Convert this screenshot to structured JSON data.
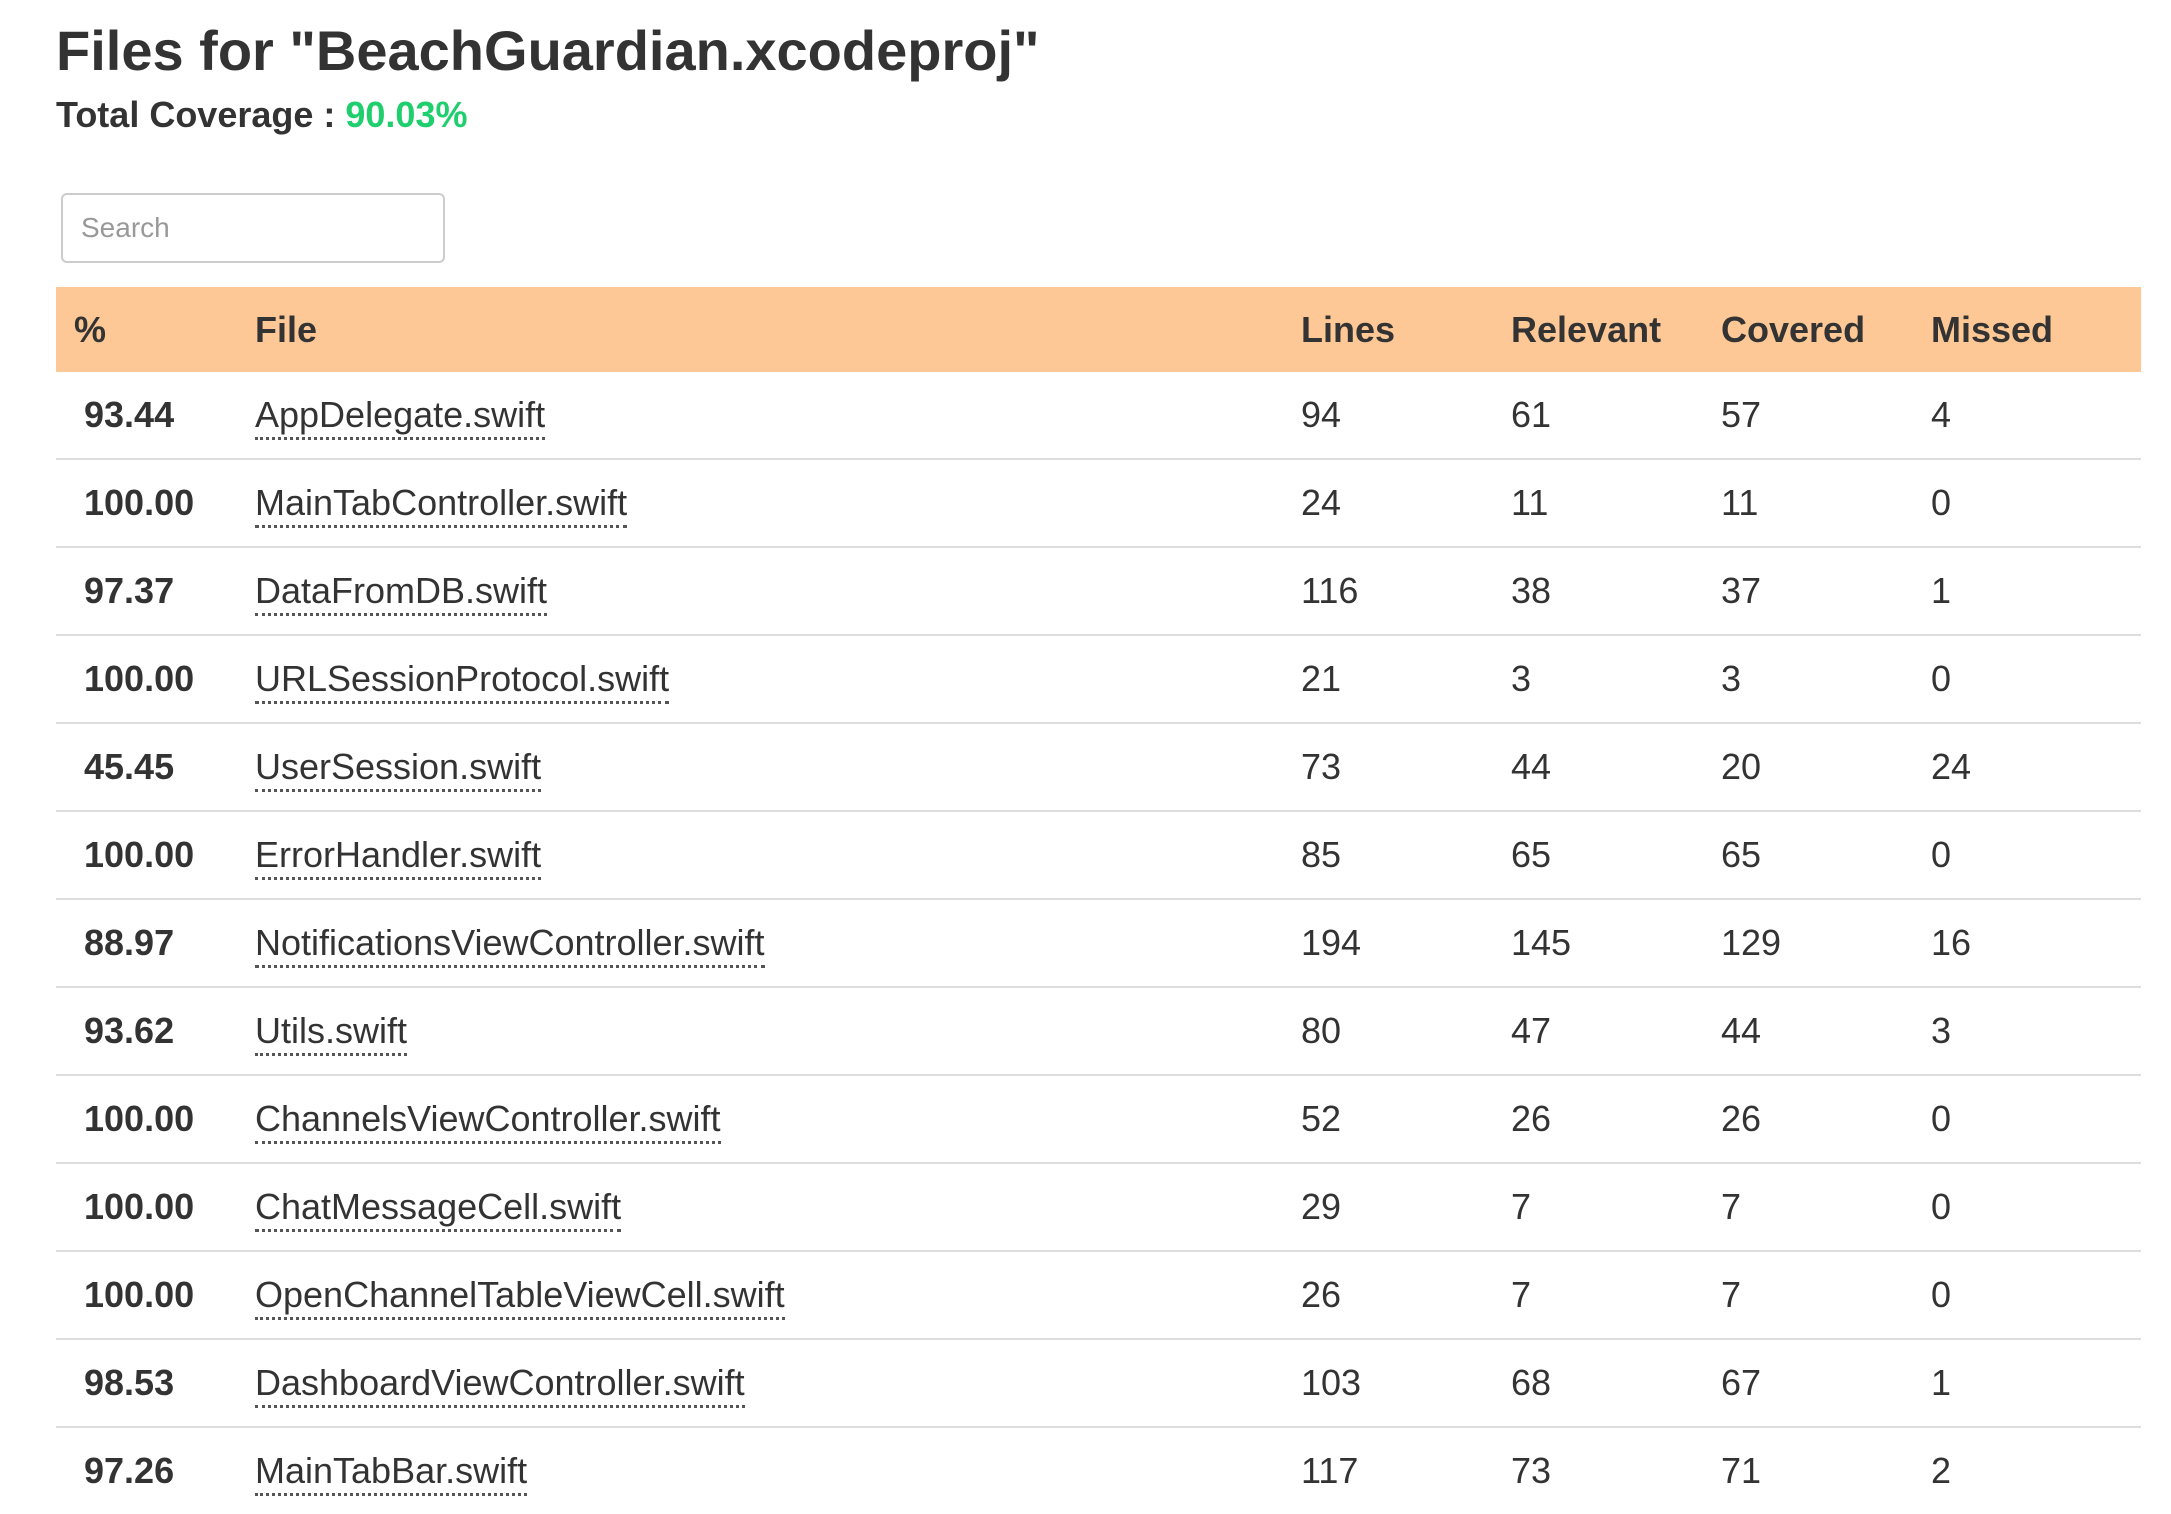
{
  "page": {
    "title": "Files for \"BeachGuardian.xcodeproj\"",
    "coverage_label": "Total Coverage : ",
    "coverage_value": "90.03%"
  },
  "search": {
    "placeholder": "Search"
  },
  "table": {
    "headers": {
      "pct": "%",
      "file": "File",
      "lines": "Lines",
      "relevant": "Relevant",
      "covered": "Covered",
      "missed": "Missed"
    },
    "rows": [
      {
        "pct": "93.44",
        "level": "high",
        "file": "AppDelegate.swift",
        "lines": "94",
        "relevant": "61",
        "covered": "57",
        "missed": "4"
      },
      {
        "pct": "100.00",
        "level": "high",
        "file": "MainTabController.swift",
        "lines": "24",
        "relevant": "11",
        "covered": "11",
        "missed": "0"
      },
      {
        "pct": "97.37",
        "level": "high",
        "file": "DataFromDB.swift",
        "lines": "116",
        "relevant": "38",
        "covered": "37",
        "missed": "1"
      },
      {
        "pct": "100.00",
        "level": "high",
        "file": "URLSessionProtocol.swift",
        "lines": "21",
        "relevant": "3",
        "covered": "3",
        "missed": "0"
      },
      {
        "pct": "45.45",
        "level": "low",
        "file": "UserSession.swift",
        "lines": "73",
        "relevant": "44",
        "covered": "20",
        "missed": "24"
      },
      {
        "pct": "100.00",
        "level": "high",
        "file": "ErrorHandler.swift",
        "lines": "85",
        "relevant": "65",
        "covered": "65",
        "missed": "0"
      },
      {
        "pct": "88.97",
        "level": "high",
        "file": "NotificationsViewController.swift",
        "lines": "194",
        "relevant": "145",
        "covered": "129",
        "missed": "16"
      },
      {
        "pct": "93.62",
        "level": "high",
        "file": "Utils.swift",
        "lines": "80",
        "relevant": "47",
        "covered": "44",
        "missed": "3"
      },
      {
        "pct": "100.00",
        "level": "high",
        "file": "ChannelsViewController.swift",
        "lines": "52",
        "relevant": "26",
        "covered": "26",
        "missed": "0"
      },
      {
        "pct": "100.00",
        "level": "high",
        "file": "ChatMessageCell.swift",
        "lines": "29",
        "relevant": "7",
        "covered": "7",
        "missed": "0"
      },
      {
        "pct": "100.00",
        "level": "high",
        "file": "OpenChannelTableViewCell.swift",
        "lines": "26",
        "relevant": "7",
        "covered": "7",
        "missed": "0"
      },
      {
        "pct": "98.53",
        "level": "high",
        "file": "DashboardViewController.swift",
        "lines": "103",
        "relevant": "68",
        "covered": "67",
        "missed": "1"
      },
      {
        "pct": "97.26",
        "level": "high",
        "file": "MainTabBar.swift",
        "lines": "117",
        "relevant": "73",
        "covered": "71",
        "missed": "2"
      }
    ]
  },
  "colors": {
    "header_bg": "#fdc895",
    "coverage_high": "#1fce6d",
    "coverage_low": "#f45d5d",
    "row_border": "#dddddd"
  }
}
